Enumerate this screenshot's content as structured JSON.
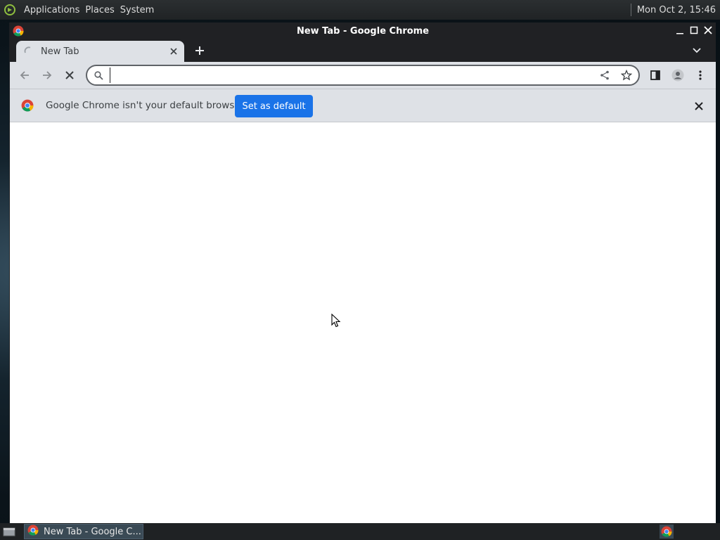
{
  "top_panel": {
    "menus": [
      "Applications",
      "Places",
      "System"
    ],
    "clock": "Mon Oct  2, 15:46"
  },
  "window": {
    "title": "New Tab - Google Chrome"
  },
  "tabs": [
    {
      "title": "New Tab",
      "loading": true
    }
  ],
  "omnibox": {
    "value": "",
    "placeholder": ""
  },
  "infobar": {
    "message": "Google Chrome isn't your default browser",
    "button_label": "Set as default"
  },
  "taskbar": {
    "items": [
      {
        "label": "New Tab - Google C..."
      }
    ]
  },
  "colors": {
    "accent": "#1a73e8",
    "toolbar": "#dee1e6",
    "titlebar": "#202124"
  },
  "icons": [
    "os-logo-icon",
    "chrome-icon",
    "minimize-icon",
    "maximize-icon",
    "close-icon",
    "loading-spinner-icon",
    "plus-icon",
    "chevron-down-icon",
    "back-arrow-icon",
    "forward-arrow-icon",
    "stop-icon",
    "search-icon",
    "share-icon",
    "star-icon",
    "side-panel-icon",
    "profile-icon",
    "more-vert-icon",
    "show-desktop-icon"
  ]
}
